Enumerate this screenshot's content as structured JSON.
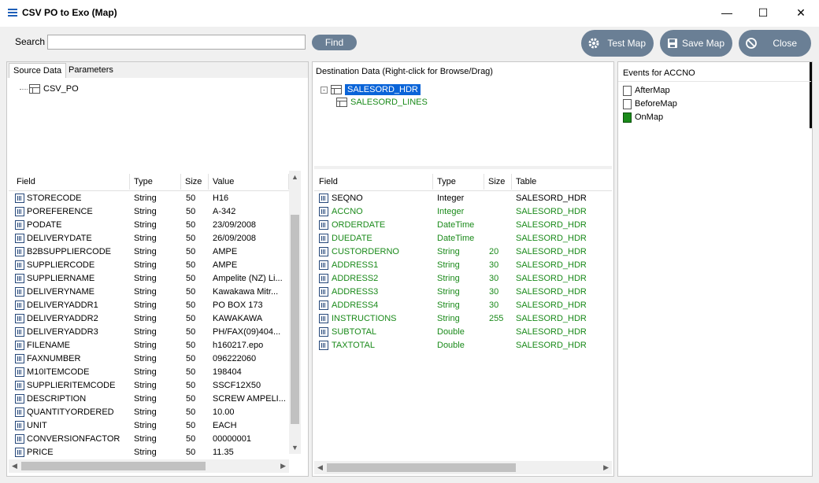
{
  "window": {
    "title": "CSV PO to Exo (Map)"
  },
  "toolbar": {
    "search_label": "Search",
    "search_value": "",
    "find_label": "Find",
    "test_map_label": "Test Map",
    "save_map_label": "Save Map",
    "close_label": "Close"
  },
  "source": {
    "tabs": [
      "Source Data",
      "Parameters"
    ],
    "tree_root": "CSV_PO",
    "columns": [
      "Field",
      "Type",
      "Size",
      "Value"
    ],
    "rows": [
      {
        "field": "STORECODE",
        "type": "String",
        "size": "50",
        "value": "H16"
      },
      {
        "field": "POREFERENCE",
        "type": "String",
        "size": "50",
        "value": "A-342"
      },
      {
        "field": "PODATE",
        "type": "String",
        "size": "50",
        "value": "23/09/2008"
      },
      {
        "field": "DELIVERYDATE",
        "type": "String",
        "size": "50",
        "value": "26/09/2008"
      },
      {
        "field": "B2BSUPPLIERCODE",
        "type": "String",
        "size": "50",
        "value": "AMPE"
      },
      {
        "field": "SUPPLIERCODE",
        "type": "String",
        "size": "50",
        "value": "AMPE"
      },
      {
        "field": "SUPPLIERNAME",
        "type": "String",
        "size": "50",
        "value": "Ampelite (NZ) Li..."
      },
      {
        "field": "DELIVERYNAME",
        "type": "String",
        "size": "50",
        "value": "Kawakawa Mitr..."
      },
      {
        "field": "DELIVERYADDR1",
        "type": "String",
        "size": "50",
        "value": "PO BOX 173"
      },
      {
        "field": "DELIVERYADDR2",
        "type": "String",
        "size": "50",
        "value": "KAWAKAWA"
      },
      {
        "field": "DELIVERYADDR3",
        "type": "String",
        "size": "50",
        "value": "PH/FAX(09)404..."
      },
      {
        "field": "FILENAME",
        "type": "String",
        "size": "50",
        "value": "h160217.epo"
      },
      {
        "field": "FAXNUMBER",
        "type": "String",
        "size": "50",
        "value": "096222060"
      },
      {
        "field": "M10ITEMCODE",
        "type": "String",
        "size": "50",
        "value": "198404"
      },
      {
        "field": "SUPPLIERITEMCODE",
        "type": "String",
        "size": "50",
        "value": "SSCF12X50"
      },
      {
        "field": "DESCRIPTION",
        "type": "String",
        "size": "50",
        "value": "SCREW AMPELI..."
      },
      {
        "field": "QUANTITYORDERED",
        "type": "String",
        "size": "50",
        "value": "10.00"
      },
      {
        "field": "UNIT",
        "type": "String",
        "size": "50",
        "value": "EACH"
      },
      {
        "field": "CONVERSIONFACTOR",
        "type": "String",
        "size": "50",
        "value": "00000001"
      },
      {
        "field": "PRICE",
        "type": "String",
        "size": "50",
        "value": "11.35"
      }
    ]
  },
  "destination": {
    "header": "Destination Data  (Right-click for Browse/Drag)",
    "tree_root": "SALESORD_HDR",
    "tree_child": "SALESORD_LINES",
    "columns": [
      "Field",
      "Type",
      "Size",
      "Table"
    ],
    "rows": [
      {
        "field": "SEQNO",
        "type": "Integer",
        "size": "",
        "table": "SALESORD_HDR",
        "green": false
      },
      {
        "field": "ACCNO",
        "type": "Integer",
        "size": "",
        "table": "SALESORD_HDR",
        "green": true
      },
      {
        "field": "ORDERDATE",
        "type": "DateTime",
        "size": "",
        "table": "SALESORD_HDR",
        "green": true
      },
      {
        "field": "DUEDATE",
        "type": "DateTime",
        "size": "",
        "table": "SALESORD_HDR",
        "green": true
      },
      {
        "field": "CUSTORDERNO",
        "type": "String",
        "size": "20",
        "table": "SALESORD_HDR",
        "green": true
      },
      {
        "field": "ADDRESS1",
        "type": "String",
        "size": "30",
        "table": "SALESORD_HDR",
        "green": true
      },
      {
        "field": "ADDRESS2",
        "type": "String",
        "size": "30",
        "table": "SALESORD_HDR",
        "green": true
      },
      {
        "field": "ADDRESS3",
        "type": "String",
        "size": "30",
        "table": "SALESORD_HDR",
        "green": true
      },
      {
        "field": "ADDRESS4",
        "type": "String",
        "size": "30",
        "table": "SALESORD_HDR",
        "green": true
      },
      {
        "field": "INSTRUCTIONS",
        "type": "String",
        "size": "255",
        "table": "SALESORD_HDR",
        "green": true
      },
      {
        "field": "SUBTOTAL",
        "type": "Double",
        "size": "",
        "table": "SALESORD_HDR",
        "green": true
      },
      {
        "field": "TAXTOTAL",
        "type": "Double",
        "size": "",
        "table": "SALESORD_HDR",
        "green": true
      }
    ]
  },
  "events": {
    "header": "Events for ACCNO",
    "items": [
      {
        "label": "AfterMap",
        "filled": false
      },
      {
        "label": "BeforeMap",
        "filled": false
      },
      {
        "label": "OnMap",
        "filled": true
      }
    ]
  }
}
